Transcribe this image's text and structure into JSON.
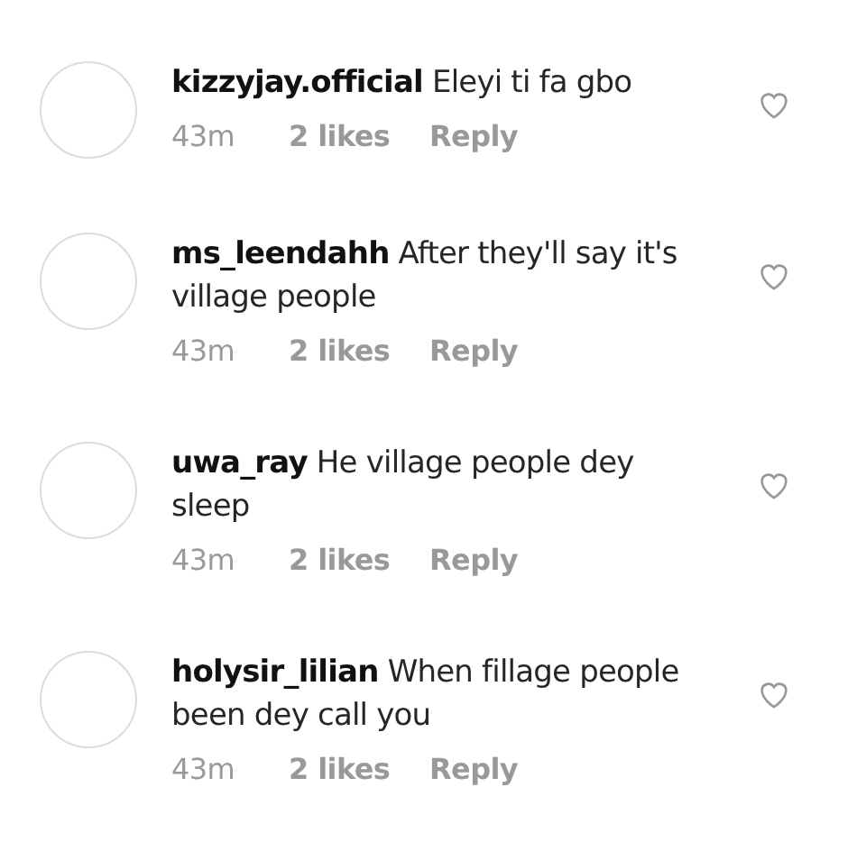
{
  "comments": [
    {
      "username": "kizzyjay.official",
      "text": "Eleyi ti fa gbo",
      "time": "43m",
      "likes": "2 likes",
      "reply": "Reply",
      "liked": false
    },
    {
      "username": "ms_leendahh",
      "text": "After they'll say it's village people",
      "time": "43m",
      "likes": "2 likes",
      "reply": "Reply",
      "liked": false
    },
    {
      "username": "uwa_ray",
      "text": "He village people dey sleep",
      "time": "43m",
      "likes": "2 likes",
      "reply": "Reply",
      "liked": false
    },
    {
      "username": "holysir_lilian",
      "text": "When fillage people been dey call you",
      "time": "43m",
      "likes": "2 likes",
      "reply": "Reply",
      "liked": false
    }
  ]
}
